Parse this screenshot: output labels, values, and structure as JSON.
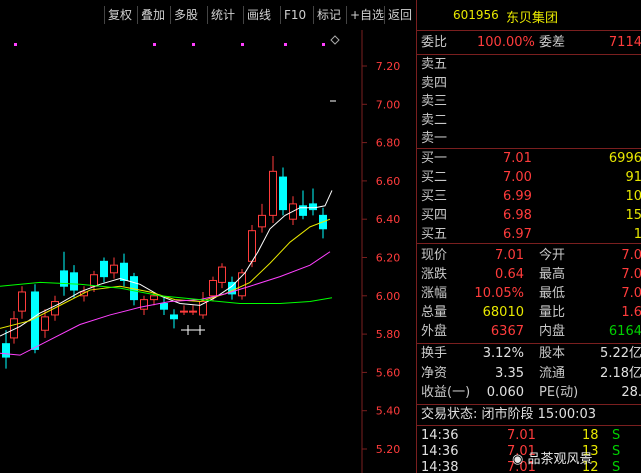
{
  "toolbar": {
    "buttons": [
      "复权",
      "叠加",
      "多股",
      "统计",
      "画线",
      "F10",
      "标记",
      "+自选",
      "返回"
    ]
  },
  "chart": {
    "y_labels": [
      "7.20",
      "7.00",
      "6.80",
      "6.60",
      "6.40",
      "6.20",
      "6.00",
      "5.80",
      "5.60",
      "5.40",
      "5.20"
    ],
    "colors": {
      "up": "#ff3c3c",
      "down": "#00ffff",
      "ma5": "#ffffff",
      "ma10": "#e8e800",
      "ma20": "#ff40ff",
      "ma60": "#00ff00",
      "bg": "#000000"
    }
  },
  "quote": {
    "code": "601956",
    "name": "东贝集团",
    "weibi_label": "委比",
    "weibi": "100.00%",
    "weicha_label": "委差",
    "weicha": "7114",
    "sell": [
      {
        "label": "卖五"
      },
      {
        "label": "卖四"
      },
      {
        "label": "卖三"
      },
      {
        "label": "卖二"
      },
      {
        "label": "卖一"
      }
    ],
    "buy": [
      {
        "label": "买一",
        "price": "7.01",
        "vol": "6996"
      },
      {
        "label": "买二",
        "price": "7.00",
        "vol": "91"
      },
      {
        "label": "买三",
        "price": "6.99",
        "vol": "10"
      },
      {
        "label": "买四",
        "price": "6.98",
        "vol": "15"
      },
      {
        "label": "买五",
        "price": "6.97",
        "vol": "1"
      }
    ],
    "stats": [
      {
        "l1": "现价",
        "v1": "7.01",
        "l2": "今开",
        "v2": "7.0"
      },
      {
        "l1": "涨跌",
        "v1": "0.64",
        "l2": "最高",
        "v2": "7.0"
      },
      {
        "l1": "涨幅",
        "v1": "10.05%",
        "l2": "最低",
        "v2": "7.0"
      },
      {
        "l1": "总量",
        "v1": "68010",
        "l2": "量比",
        "v2": "1.6"
      },
      {
        "l1": "外盘",
        "v1": "6367",
        "l2": "内盘",
        "v2": "6164"
      }
    ],
    "fin": [
      {
        "l1": "换手",
        "v1": "3.12%",
        "l2": "股本",
        "v2": "5.22亿"
      },
      {
        "l1": "净资",
        "v1": "3.35",
        "l2": "流通",
        "v2": "2.18亿"
      },
      {
        "l1": "收益(一)",
        "v1": "0.060",
        "l2": "PE(动)",
        "v2": "28."
      }
    ],
    "trade_status": "交易状态: 闭市阶段 15:00:03",
    "ticks": [
      {
        "time": "14:36",
        "price": "7.01",
        "vol": "18",
        "dir": "S"
      },
      {
        "time": "14:36",
        "price": "7.01",
        "vol": "13",
        "dir": "S"
      },
      {
        "time": "14:38",
        "price": "7.01",
        "vol": "12",
        "dir": "S"
      }
    ],
    "watermark": "品茶观风景"
  }
}
